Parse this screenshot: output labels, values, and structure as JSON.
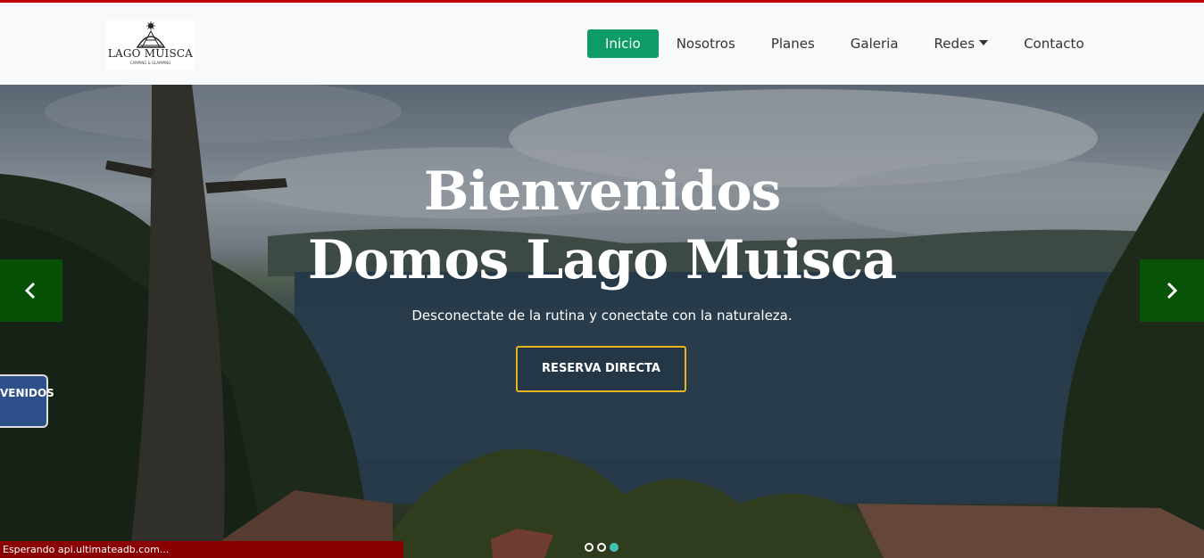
{
  "brand": {
    "logo_text": "LAGO MUISCA",
    "logo_subtext": "CAMPING & GLAMPING"
  },
  "nav": {
    "items": [
      {
        "label": "Inicio",
        "active": true
      },
      {
        "label": "Nosotros"
      },
      {
        "label": "Planes"
      },
      {
        "label": "Galeria"
      },
      {
        "label": "Redes",
        "dropdown": true
      },
      {
        "label": "Contacto"
      }
    ]
  },
  "hero": {
    "title_line1": "Bienvenidos",
    "title_line2": "Domos Lago Muisca",
    "subtitle": "Desconectate de la rutina y conectate con la naturaleza.",
    "cta_label": "RESERVA DIRECTA",
    "sign_text": "VENIDOS",
    "carousel": {
      "slides": 3,
      "active_index": 2
    }
  },
  "status_bar": {
    "text": "Esperando api.ultimateadb.com..."
  },
  "colors": {
    "accent_green": "#0d9b66",
    "cta_border": "#e7b41c",
    "top_border": "#c0000c",
    "status_bar": "#8a0000",
    "indicator_active": "#3ec3b6"
  },
  "icons": {
    "prev": "chevron-left-icon",
    "next": "chevron-right-icon",
    "dropdown": "caret-down-icon"
  }
}
